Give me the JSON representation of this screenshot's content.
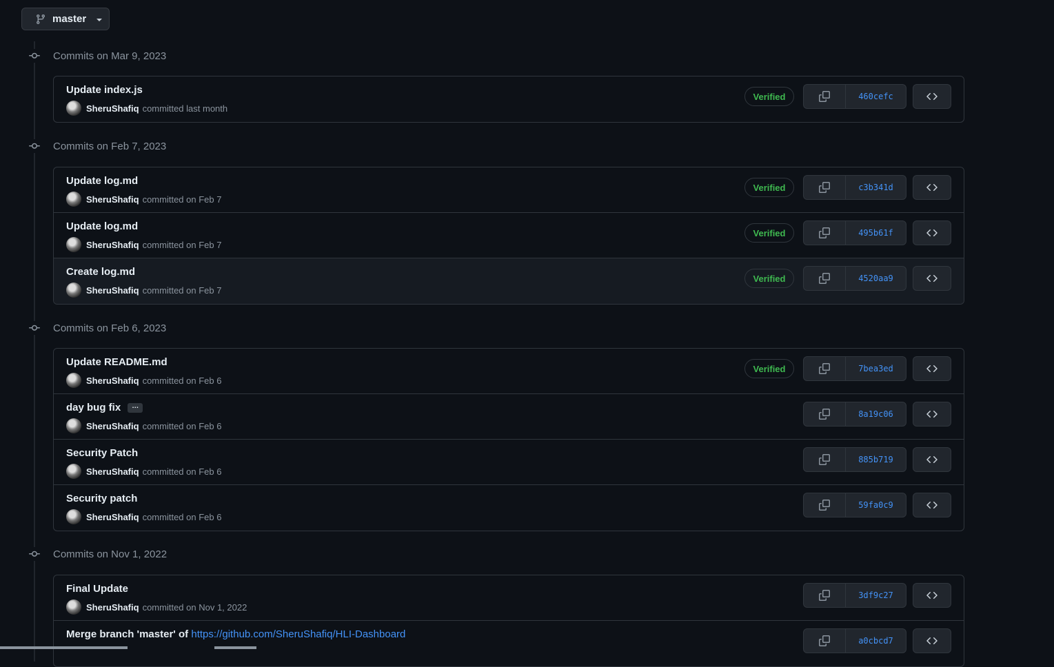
{
  "branch": {
    "label": "master"
  },
  "groups": [
    {
      "header": "Commits on Mar 9, 2023",
      "commits": [
        {
          "title": "Update index.js",
          "author": "SheruShafiq",
          "when": "committed last month",
          "verified": "Verified",
          "sha": "460cefc"
        }
      ]
    },
    {
      "header": "Commits on Feb 7, 2023",
      "commits": [
        {
          "title": "Update log.md",
          "author": "SheruShafiq",
          "when": "committed on Feb 7",
          "verified": "Verified",
          "sha": "c3b341d"
        },
        {
          "title": "Update log.md",
          "author": "SheruShafiq",
          "when": "committed on Feb 7",
          "verified": "Verified",
          "sha": "495b61f"
        },
        {
          "title": "Create log.md",
          "author": "SheruShafiq",
          "when": "committed on Feb 7",
          "verified": "Verified",
          "sha": "4520aa9"
        }
      ]
    },
    {
      "header": "Commits on Feb 6, 2023",
      "commits": [
        {
          "title": "Update README.md",
          "author": "SheruShafiq",
          "when": "committed on Feb 6",
          "verified": "Verified",
          "sha": "7bea3ed"
        },
        {
          "title": "day bug fix",
          "ellipsis": "…",
          "author": "SheruShafiq",
          "when": "committed on Feb 6",
          "sha": "8a19c06"
        },
        {
          "title": "Security Patch",
          "author": "SheruShafiq",
          "when": "committed on Feb 6",
          "sha": "885b719"
        },
        {
          "title": "Security patch",
          "author": "SheruShafiq",
          "when": "committed on Feb 6",
          "sha": "59fa0c9"
        }
      ]
    },
    {
      "header": "Commits on Nov 1, 2022",
      "commits": [
        {
          "title": "Final Update",
          "author": "SheruShafiq",
          "when": "committed on Nov 1, 2022",
          "sha": "3df9c27"
        },
        {
          "title": "Merge branch 'master' of",
          "link": "https://github.com/SheruShafiq/HLI-Dashboard",
          "sha": "a0cbcd7"
        }
      ]
    }
  ],
  "icons": {
    "branch": "git-branch-icon",
    "timeline": "git-commit-icon",
    "copy": "copy-icon",
    "browse": "code-icon"
  },
  "colors": {
    "background": "#0d1117",
    "border": "#30363d",
    "link": "#4493f8",
    "verified": "#3fb950",
    "muted": "#8b949e"
  }
}
